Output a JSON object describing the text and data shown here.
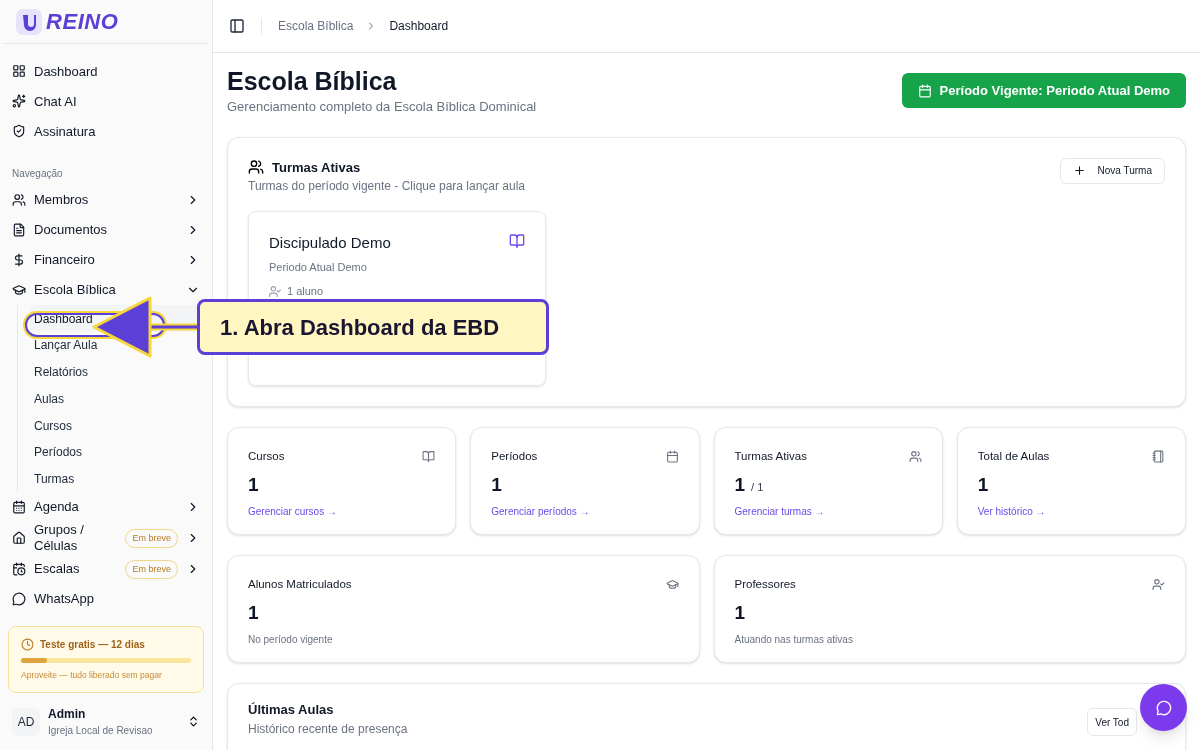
{
  "sidebar": {
    "brand": "REINO",
    "top_links": [
      {
        "label": "Dashboard"
      },
      {
        "label": "Chat AI"
      },
      {
        "label": "Assinatura"
      }
    ],
    "section_label": "Navegação",
    "items": [
      {
        "label": "Membros",
        "kind": "submenu",
        "expanded": false
      },
      {
        "label": "Documentos",
        "kind": "submenu",
        "expanded": false
      },
      {
        "label": "Financeiro",
        "kind": "submenu",
        "expanded": false
      },
      {
        "label": "Escola Bíblica",
        "kind": "submenu",
        "expanded": true,
        "children": [
          {
            "label": "Dashboard",
            "selected": true
          },
          {
            "label": "Lançar Aula",
            "selected": false
          },
          {
            "label": "Relatórios",
            "selected": false
          },
          {
            "label": "Aulas",
            "selected": false
          },
          {
            "label": "Cursos",
            "selected": false
          },
          {
            "label": "Períodos",
            "selected": false
          },
          {
            "label": "Turmas",
            "selected": false
          }
        ]
      },
      {
        "label": "Agenda",
        "kind": "submenu",
        "expanded": false
      },
      {
        "label": "Grupos / Células",
        "kind": "submenu",
        "expanded": false,
        "badge": "Em breve"
      },
      {
        "label": "Escalas",
        "kind": "submenu",
        "expanded": false,
        "badge": "Em breve"
      },
      {
        "label": "WhatsApp",
        "kind": "link"
      }
    ],
    "trial": {
      "title": "Teste gratis — 12 dias",
      "level": 0.15,
      "note": "Aproveite — tudo liberado sem pagar"
    },
    "user": {
      "initials": "AD",
      "name": "Admin",
      "org": "Igreja Local de Revisao"
    }
  },
  "breadcrumb": [
    "Escola Bíblica",
    "Dashboard"
  ],
  "page": {
    "title": "Escola Bíblica",
    "subtitle": "Gerenciamento completo da Escola Bíblica Dominical",
    "period_button": "Período Vigente: Periodo Atual Demo"
  },
  "active_classes": {
    "title": "Turmas Ativas",
    "subtitle": "Turmas do período vigente - Clique para lançar aula",
    "new_button": "Nova Turma",
    "classes": [
      {
        "name": "Discipulado Demo",
        "period": "Periodo Atual Demo",
        "students": "1 aluno"
      }
    ]
  },
  "stats": [
    {
      "label": "Cursos",
      "value": "1",
      "link": "Gerenciar cursos →"
    },
    {
      "label": "Períodos",
      "value": "1",
      "link": "Gerenciar períodos →"
    },
    {
      "label": "Turmas Ativas",
      "value": "1",
      "suffix": "/ 1",
      "link": "Gerenciar turmas →"
    },
    {
      "label": "Total de Aulas",
      "value": "1",
      "link": "Ver histórico →"
    }
  ],
  "stats_wide": [
    {
      "label": "Alunos Matriculados",
      "value": "1",
      "note": "No período vigente"
    },
    {
      "label": "Professores",
      "value": "1",
      "note": "Atuando nas turmas ativas"
    }
  ],
  "recent_lessons": {
    "title": "Últimas Aulas",
    "subtitle": "Histórico recente de presença",
    "button": "Ver Tod"
  },
  "tutorial_callout": {
    "text": "1. Abra Dashboard da EBD"
  }
}
